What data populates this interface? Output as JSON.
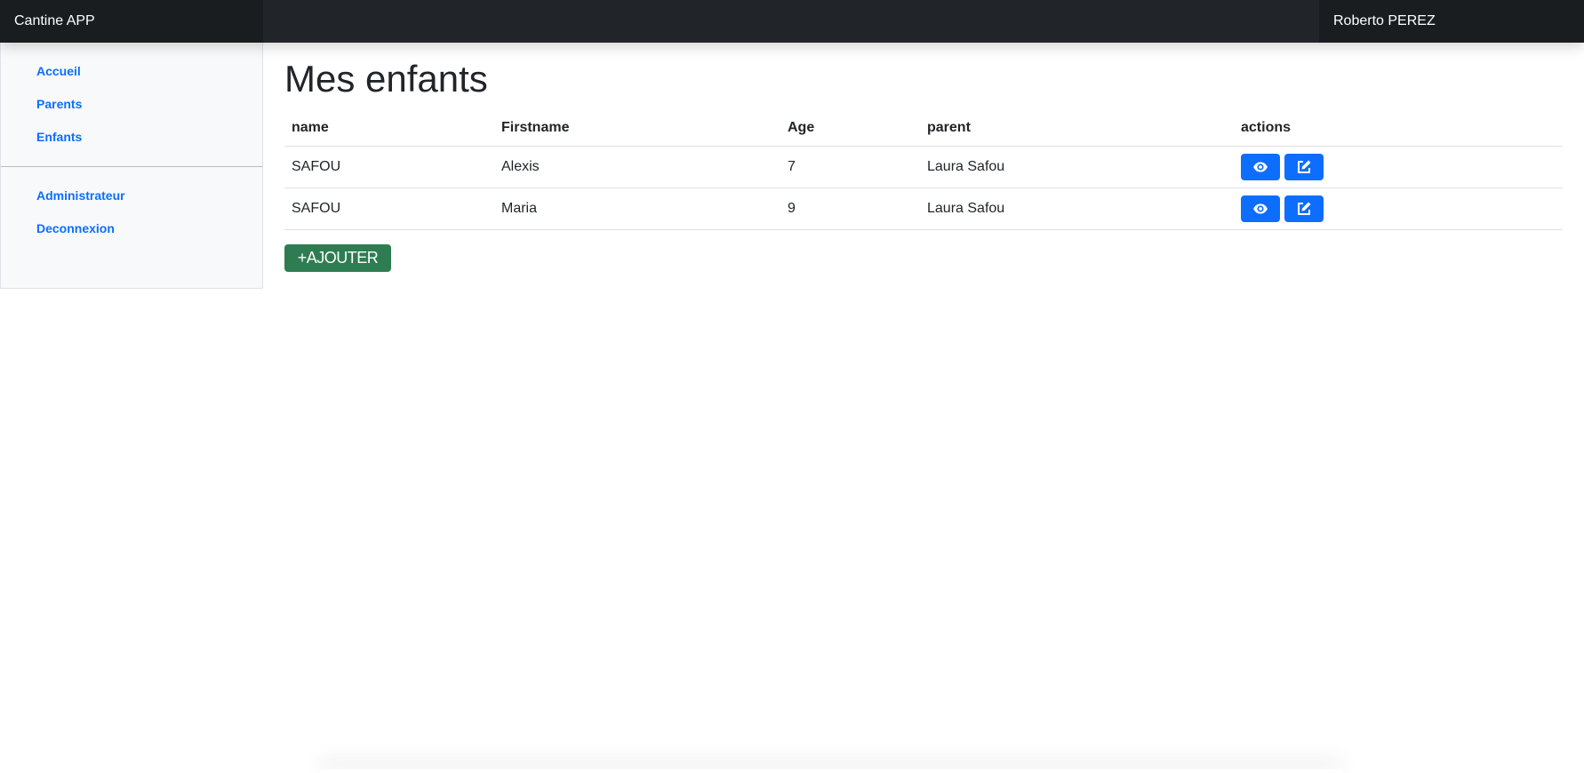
{
  "app": {
    "title": "Cantine APP"
  },
  "user": {
    "name": "Roberto PEREZ"
  },
  "sidebar": {
    "top_items": [
      {
        "label": "Accueil"
      },
      {
        "label": "Parents"
      },
      {
        "label": "Enfants"
      }
    ],
    "bottom_items": [
      {
        "label": "Administrateur"
      },
      {
        "label": "Deconnexion"
      }
    ]
  },
  "main": {
    "title": "Mes enfants",
    "table": {
      "headers": [
        "name",
        "Firstname",
        "Age",
        "parent",
        "actions"
      ],
      "rows": [
        {
          "name": "SAFOU",
          "firstname": "Alexis",
          "age": "7",
          "parent": "Laura Safou"
        },
        {
          "name": "SAFOU",
          "firstname": "Maria",
          "age": "9",
          "parent": "Laura Safou"
        }
      ],
      "action_icons": [
        "eye-icon",
        "edit-icon"
      ]
    },
    "add_button": {
      "label": "+AJOUTER"
    }
  },
  "colors": {
    "topbar": "#212529",
    "link": "#0d6efd",
    "action_button": "#0d6efd",
    "add_button": "#2e7d52",
    "sidebar_bg": "#f8f9fa"
  }
}
